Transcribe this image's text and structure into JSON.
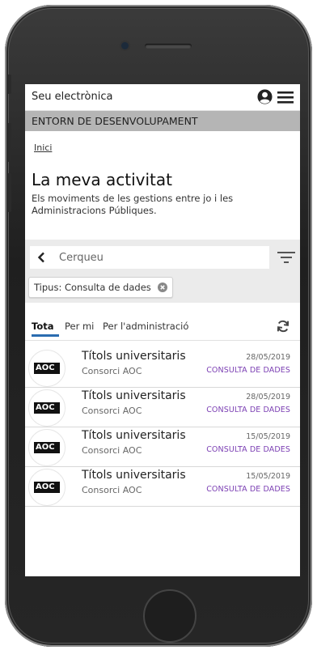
{
  "header": {
    "site_title": "Seu electrònica"
  },
  "environment_banner": "ENTORN DE DESENVOLUPAMENT",
  "breadcrumb": {
    "home": "Inici"
  },
  "page": {
    "title": "La meva activitat",
    "description": "Els moviments de les gestions entre jo i les Administracions Públiques."
  },
  "search": {
    "placeholder": "Cerqueu"
  },
  "active_filter": {
    "label": "Tipus: Consulta de dades"
  },
  "tabs": [
    {
      "label": "Tota"
    },
    {
      "label": "Per mi"
    },
    {
      "label": "Per l'administració"
    }
  ],
  "activities": [
    {
      "title": "Títols universitaris",
      "org": "Consorci AOC",
      "date": "28/05/2019",
      "type": "CONSULTA DE DADES"
    },
    {
      "title": "Títols universitaris",
      "org": "Consorci AOC",
      "date": "28/05/2019",
      "type": "CONSULTA DE DADES"
    },
    {
      "title": "Títols universitaris",
      "org": "Consorci AOC",
      "date": "15/05/2019",
      "type": "CONSULTA DE DADES"
    },
    {
      "title": "Títols universitaris",
      "org": "Consorci AOC",
      "date": "15/05/2019",
      "type": "CONSULTA DE DADES"
    }
  ],
  "logo_text": "AOC",
  "colors": {
    "accent": "#2b6cb0",
    "type_label": "#7b3fb3",
    "banner": "#b5b5b5",
    "logo_red": "#d0021b"
  },
  "icons": {
    "user": "user-circle-icon",
    "menu": "hamburger-menu-icon",
    "back": "chevron-left-icon",
    "filter": "filter-icon",
    "chip_close": "close-circle-icon",
    "refresh": "refresh-icon"
  }
}
